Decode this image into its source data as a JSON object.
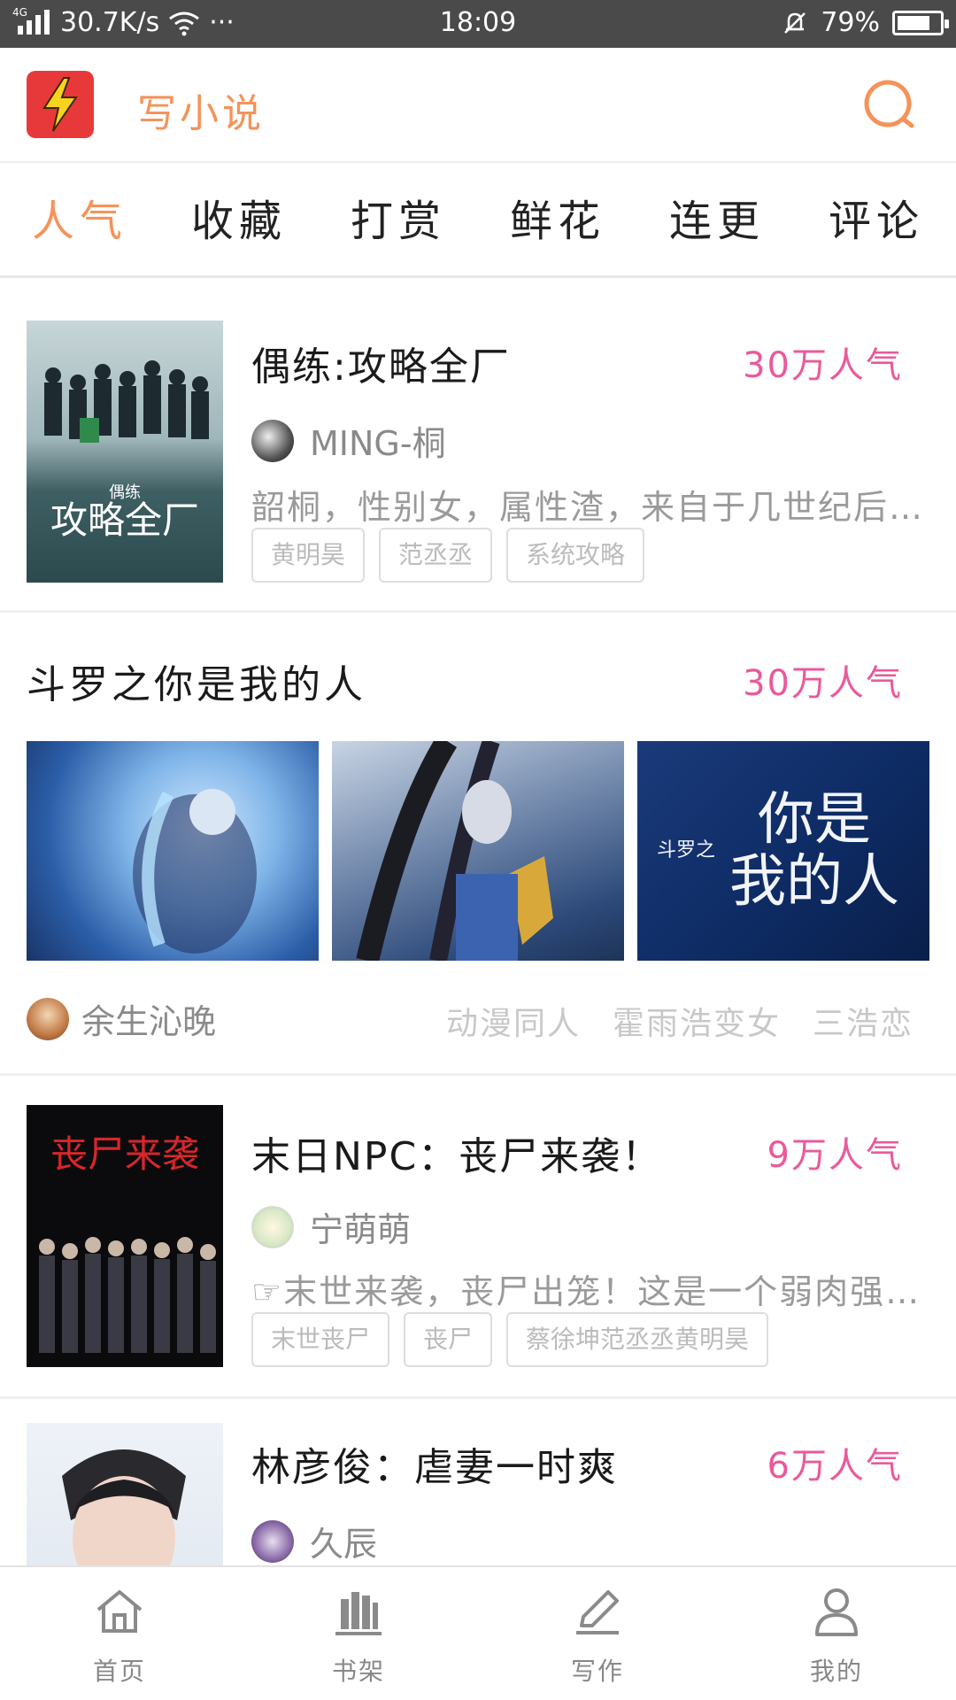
{
  "status_bar": {
    "network": "4G",
    "speed": "30.7K/s",
    "more": "···",
    "time": "18:09",
    "battery_percent": "79%",
    "battery_level": 0.79
  },
  "header": {
    "app_title": "写小说",
    "logo_icon": "lightning-icon",
    "search_icon": "search-icon"
  },
  "tabs": [
    {
      "label": "人气",
      "active": true
    },
    {
      "label": "收藏",
      "active": false
    },
    {
      "label": "打赏",
      "active": false
    },
    {
      "label": "鲜花",
      "active": false
    },
    {
      "label": "连更",
      "active": false
    },
    {
      "label": "评论",
      "active": false
    }
  ],
  "books": [
    {
      "title": "偶练:攻略全厂",
      "popularity": "30万人气",
      "author": "MING-桐",
      "desc": "韶桐，性别女，属性渣，来自于几世纪后…",
      "tags": [
        "黄明昊",
        "范丞丞",
        "系统攻略"
      ]
    },
    {
      "title": "末日NPC：丧尸来袭！",
      "popularity": "9万人气",
      "author": "宁萌萌",
      "desc": "☞末世来袭，丧尸出笼！这是一个弱肉强…",
      "tags": [
        "末世丧尸",
        "丧尸",
        "蔡徐坤范丞丞黄明昊"
      ]
    },
    {
      "title": "林彦俊：虐妻一时爽",
      "popularity": "6万人气",
      "author": "久辰"
    }
  ],
  "featured": {
    "title": "斗罗之你是我的人",
    "popularity": "30万人气",
    "author": "余生沁晚",
    "tags": [
      "动漫同人",
      "霍雨浩变女",
      "三浩恋"
    ]
  },
  "bottom_nav": [
    {
      "label": "首页",
      "icon": "home-icon"
    },
    {
      "label": "书架",
      "icon": "bookshelf-icon"
    },
    {
      "label": "写作",
      "icon": "pen-icon"
    },
    {
      "label": "我的",
      "icon": "user-icon"
    }
  ],
  "colors": {
    "accent": "#f4935a",
    "popularity": "#ea5a9a",
    "logo": "#e8393a",
    "status_bar": "#4a4a4a"
  }
}
